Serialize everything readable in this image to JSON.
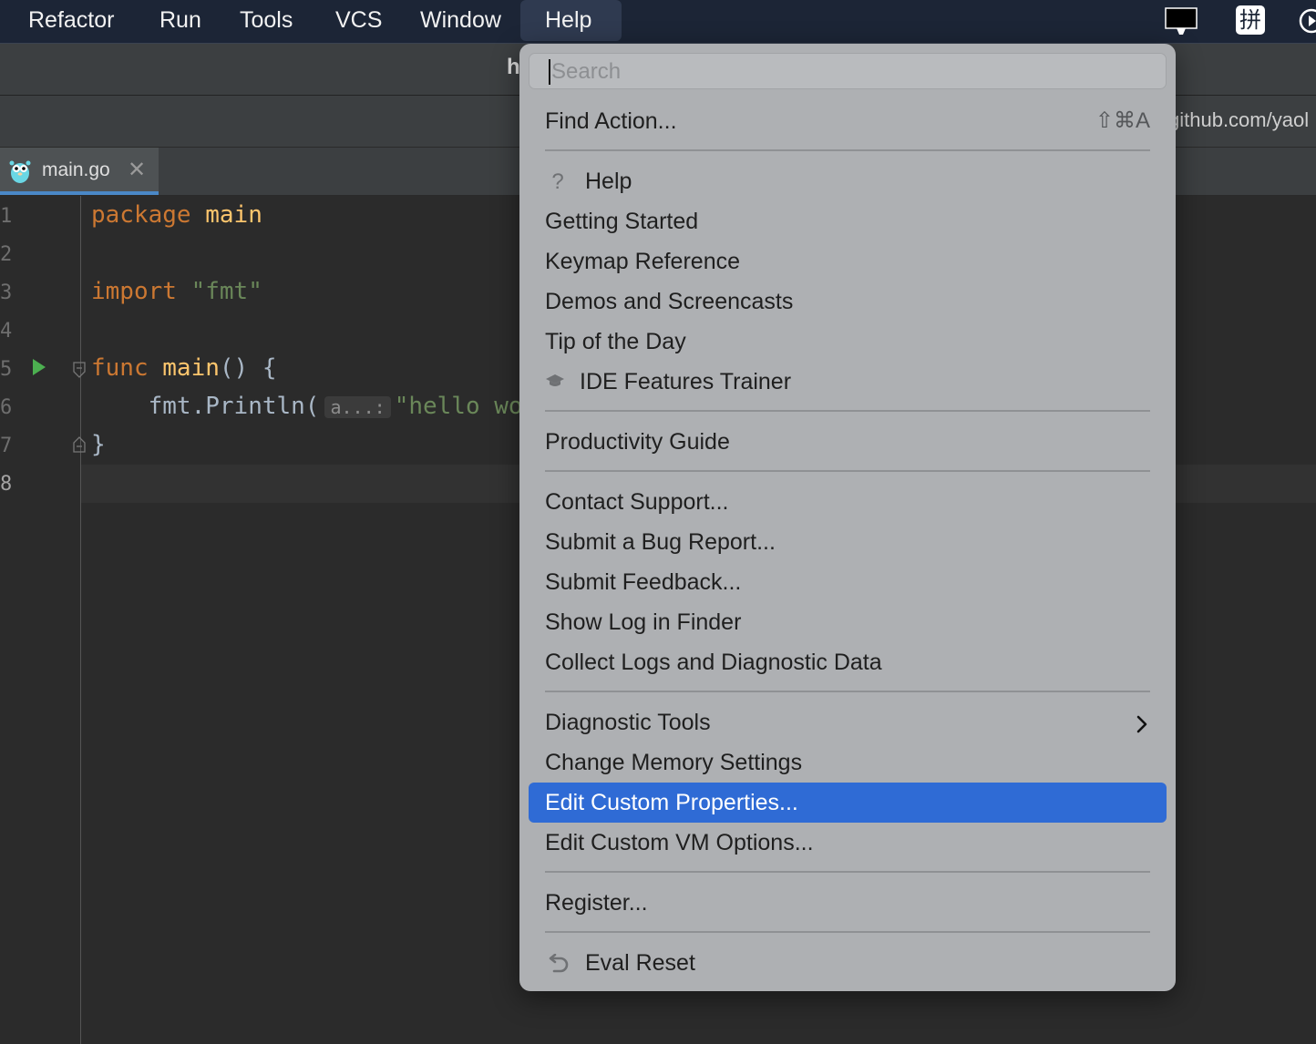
{
  "menubar": {
    "items": [
      "Refactor",
      "Run",
      "Tools",
      "VCS",
      "Window",
      "Help"
    ],
    "active": "Help"
  },
  "tray": {
    "ime_label": "拼"
  },
  "titlebar": {
    "title_fragment": "h"
  },
  "navbar": {
    "url_fragment": "github.com/yaol"
  },
  "tab": {
    "filename": "main.go"
  },
  "editor": {
    "line_numbers": [
      "1",
      "2",
      "3",
      "4",
      "5",
      "6",
      "7",
      "8"
    ],
    "code": {
      "l1_kw": "package",
      "l1_name": "main",
      "l3_kw": "import",
      "l3_str": "\"fmt\"",
      "l5_kw": "func",
      "l5_fn": "main",
      "l5_rest": "() {",
      "l6_pkg": "fmt.Println(",
      "l6_hint": "a...:",
      "l6_str": "\"hello wo",
      "l7": "}"
    }
  },
  "help_menu": {
    "search_placeholder": "Search",
    "find_action": {
      "label": "Find Action...",
      "shortcut": "⇧⌘A"
    },
    "help": "Help",
    "getting_started": "Getting Started",
    "keymap_reference": "Keymap Reference",
    "demos": "Demos and Screencasts",
    "tip_of_day": "Tip of the Day",
    "ide_trainer": "IDE Features Trainer",
    "productivity_guide": "Productivity Guide",
    "contact_support": "Contact Support...",
    "submit_bug": "Submit a Bug Report...",
    "submit_feedback": "Submit Feedback...",
    "show_log": "Show Log in Finder",
    "collect_logs": "Collect Logs and Diagnostic Data",
    "diagnostic_tools": "Diagnostic Tools",
    "change_memory": "Change Memory Settings",
    "edit_custom_props": "Edit Custom Properties...",
    "edit_vm_options": "Edit Custom VM Options...",
    "register": "Register...",
    "eval_reset": "Eval Reset",
    "selected": "Edit Custom Properties...",
    "selection_color": "#2f6bd5"
  }
}
